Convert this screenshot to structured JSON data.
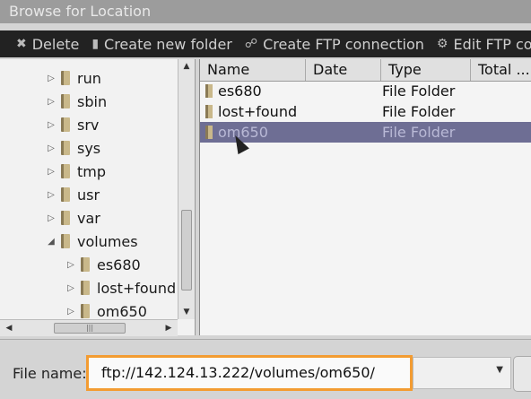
{
  "window": {
    "title": "Browse for Location"
  },
  "toolbar": {
    "delete_label": "Delete",
    "create_folder_label": "Create new folder",
    "create_ftp_label": "Create FTP connection",
    "edit_ftp_label": "Edit FTP cor"
  },
  "tree": {
    "items": [
      {
        "label": "run",
        "level": 1,
        "expander": "▷"
      },
      {
        "label": "sbin",
        "level": 1,
        "expander": "▷"
      },
      {
        "label": "srv",
        "level": 1,
        "expander": "▷"
      },
      {
        "label": "sys",
        "level": 1,
        "expander": "▷"
      },
      {
        "label": "tmp",
        "level": 1,
        "expander": "▷"
      },
      {
        "label": "usr",
        "level": 1,
        "expander": "▷"
      },
      {
        "label": "var",
        "level": 1,
        "expander": "▷"
      },
      {
        "label": "volumes",
        "level": 1,
        "expander": "◢"
      },
      {
        "label": "es680",
        "level": 2,
        "expander": "▷"
      },
      {
        "label": "lost+found",
        "level": 2,
        "expander": "▷"
      },
      {
        "label": "om650",
        "level": 2,
        "expander": "▷"
      }
    ]
  },
  "list": {
    "columns": [
      "Name",
      "Date",
      "Type",
      "Total ..."
    ],
    "rows": [
      {
        "name": "es680",
        "type": "File Folder",
        "selected": false
      },
      {
        "name": "lost+found",
        "type": "File Folder",
        "selected": false
      },
      {
        "name": "om650",
        "type": "File Folder",
        "selected": true
      }
    ]
  },
  "bottom": {
    "file_name_label": "File name:",
    "file_name_value": "ftp://142.124.13.222/volumes/om650/"
  },
  "colors": {
    "selection": "#6e6e94",
    "highlight_border": "#f39c32"
  }
}
